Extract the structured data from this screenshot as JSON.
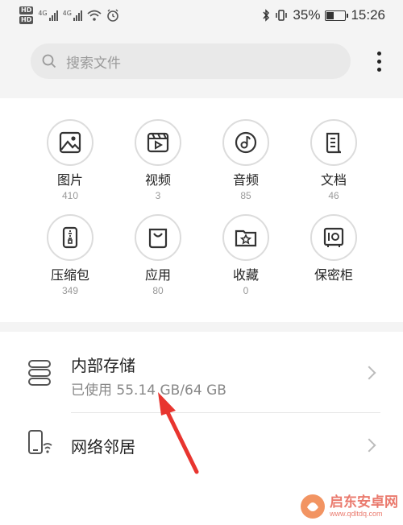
{
  "status_bar": {
    "hd_1": "HD",
    "hd_2": "HD",
    "net_1": "4G",
    "net_2": "4G",
    "battery_percent": "35%",
    "battery_level": 0.35,
    "time": "15:26"
  },
  "search": {
    "placeholder": "搜索文件"
  },
  "categories": [
    {
      "label": "图片",
      "count": "410",
      "icon": "image-icon"
    },
    {
      "label": "视频",
      "count": "3",
      "icon": "video-icon"
    },
    {
      "label": "音频",
      "count": "85",
      "icon": "music-icon"
    },
    {
      "label": "文档",
      "count": "46",
      "icon": "document-icon"
    },
    {
      "label": "压缩包",
      "count": "349",
      "icon": "archive-icon"
    },
    {
      "label": "应用",
      "count": "80",
      "icon": "app-bag-icon"
    },
    {
      "label": "收藏",
      "count": "0",
      "icon": "favorite-folder-icon"
    },
    {
      "label": "保密柜",
      "count": "",
      "icon": "safe-icon"
    }
  ],
  "storage": {
    "internal_title": "内部存储",
    "internal_usage": "已使用 55.14 GB/64 GB",
    "network_title": "网络邻居"
  },
  "watermark": {
    "name": "启东安卓网",
    "url": "www.qdltdq.com"
  },
  "colors": {
    "annotation_arrow": "#e8352f",
    "background": "#f4f4f4",
    "card": "#ffffff"
  }
}
